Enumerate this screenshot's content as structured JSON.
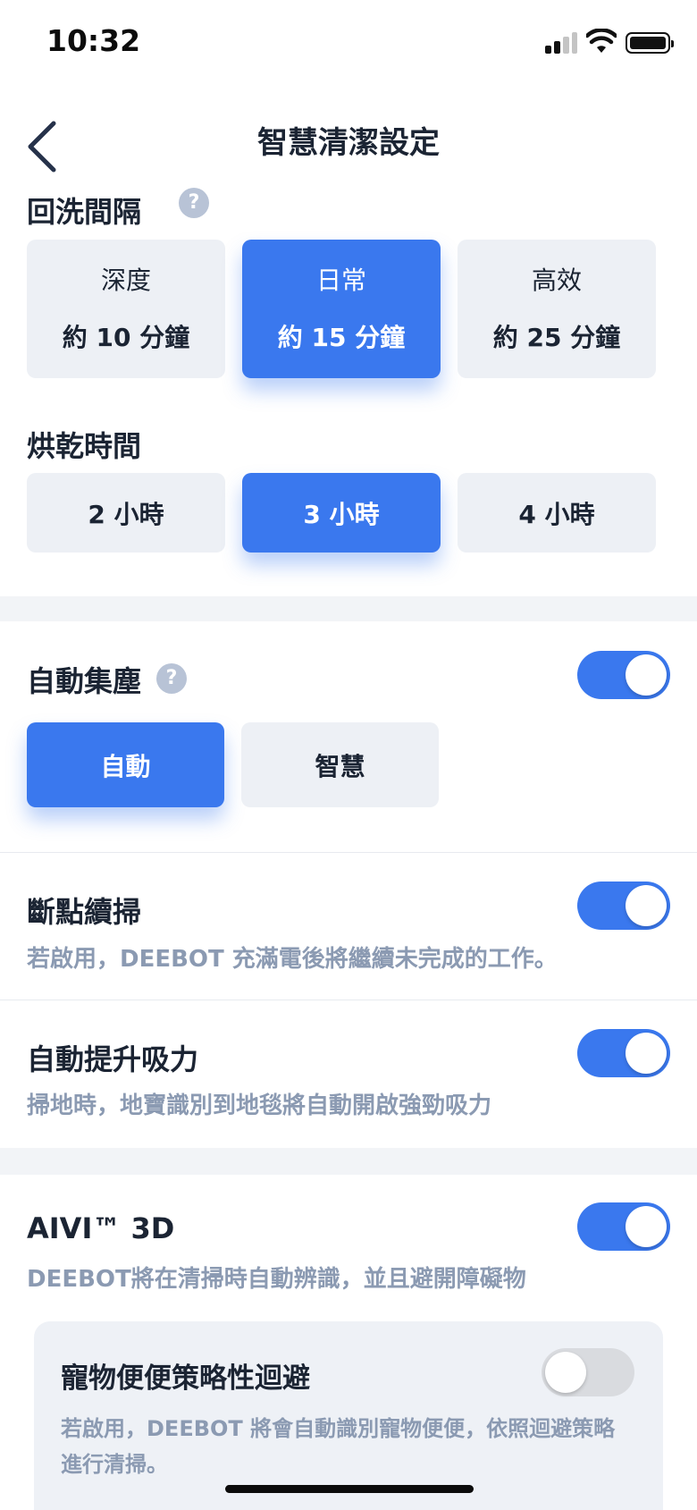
{
  "status_bar": {
    "time": "10:32"
  },
  "nav": {
    "title": "智慧清潔設定"
  },
  "wash_interval": {
    "label": "回洗間隔",
    "options": [
      {
        "title": "深度",
        "subtitle": "約 10 分鐘",
        "selected": false
      },
      {
        "title": "日常",
        "subtitle": "約 15 分鐘",
        "selected": true
      },
      {
        "title": "高效",
        "subtitle": "約 25 分鐘",
        "selected": false
      }
    ]
  },
  "drying_time": {
    "label": "烘乾時間",
    "options": [
      {
        "label": "2 小時",
        "selected": false
      },
      {
        "label": "3 小時",
        "selected": true
      },
      {
        "label": "4 小時",
        "selected": false
      }
    ]
  },
  "auto_empty": {
    "label": "自動集塵",
    "enabled": true,
    "options": [
      {
        "label": "自動",
        "selected": true
      },
      {
        "label": "智慧",
        "selected": false
      }
    ]
  },
  "resume_cleaning": {
    "label": "斷點續掃",
    "enabled": true,
    "description": "若啟用，DEEBOT 充滿電後將繼續未完成的工作。"
  },
  "auto_boost": {
    "label": "自動提升吸力",
    "enabled": true,
    "description": "掃地時，地寶識別到地毯將自動開啟強勁吸力"
  },
  "aivi": {
    "label": "AIVI™ 3D",
    "enabled": true,
    "description": "DEEBOT將在清掃時自動辨識，並且避開障礙物"
  },
  "pet_poop": {
    "label": "寵物便便策略性迴避",
    "enabled": false,
    "description": "若啟用，DEEBOT 將會自動識別寵物便便，依照迴避策略進行清掃。"
  },
  "colors": {
    "accent": "#3a78ee",
    "muted_text": "#8b9ab2",
    "option_bg": "#edf0f5"
  },
  "icons": {
    "back": "chevron-left-icon",
    "help": "question-icon"
  }
}
